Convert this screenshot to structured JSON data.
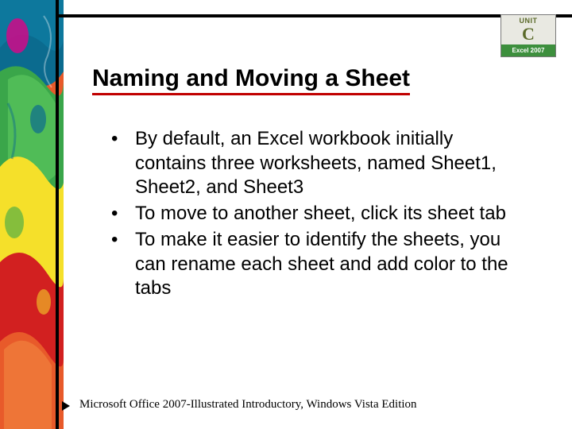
{
  "badge": {
    "unit_label": "UNIT",
    "unit_letter": "C",
    "product": "Excel 2007"
  },
  "title": "Naming and Moving a Sheet",
  "bullets": [
    "By default, an Excel workbook initially contains three worksheets, named Sheet1, Sheet2, and Sheet3",
    "To move to another sheet, click its sheet tab",
    "To make it easier to identify the sheets, you can rename each sheet and add color to the tabs"
  ],
  "footer": "Microsoft Office 2007-Illustrated Introductory, Windows Vista Edition"
}
